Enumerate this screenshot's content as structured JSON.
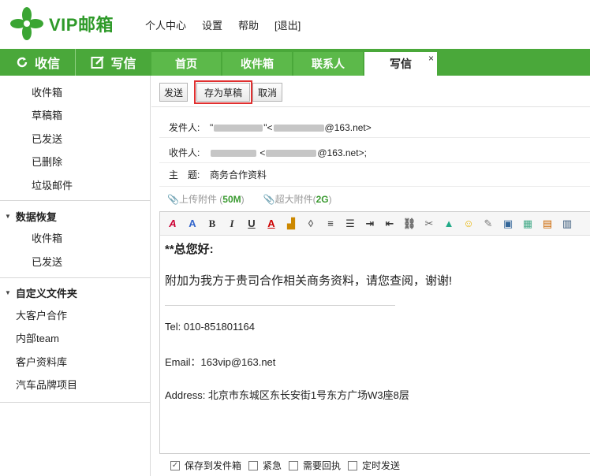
{
  "brand": {
    "name": "VIP邮箱",
    "logo_icon": "clover-logo-icon",
    "color": "#2f9a2a"
  },
  "topnav": [
    "个人中心",
    "设置",
    "帮助",
    "[退出]"
  ],
  "actions": {
    "receive": "收信",
    "compose": "写信",
    "receive_icon": "refresh-icon",
    "compose_icon": "compose-icon"
  },
  "tabs": [
    {
      "label": "首页"
    },
    {
      "label": "收件箱"
    },
    {
      "label": "联系人"
    },
    {
      "label": "写信",
      "active": true,
      "close": "×"
    }
  ],
  "sidebar": {
    "folders": [
      "收件箱",
      "草稿箱",
      "已发送",
      "已删除",
      "垃圾邮件"
    ],
    "recovery": {
      "title": "数据恢复",
      "items": [
        "收件箱",
        "已发送"
      ]
    },
    "custom": {
      "title": "自定义文件夹",
      "items": [
        "大客户合作",
        "内部team",
        "客户资料库",
        "汽车品牌项目"
      ]
    }
  },
  "compose": {
    "buttons": {
      "send": "发送",
      "draft": "存为草稿",
      "cancel": "取消"
    },
    "from_label": "发件人:",
    "from_visible": "@163.net>",
    "to_label": "收件人:",
    "to_visible": "@163.net>;",
    "subject_label": "主　题:",
    "subject": "商务合作资料",
    "attach_upload": "上传附件 (",
    "attach_upload_size": "50M",
    "attach_big": "超大附件(",
    "attach_big_size": "2G",
    "close_paren": ")"
  },
  "editor": {
    "greeting": "**总您好:",
    "body": "附加为我方于贵司合作相关商务资料，请您查阅，谢谢!",
    "tel": "Tel: 010-851801164",
    "email": "Email：163vip@163.net",
    "address": "Address: 北京市东城区东长安街1号东方广场W3座8层"
  },
  "options": [
    {
      "label": "保存到发件箱",
      "checked": true
    },
    {
      "label": "紧急",
      "checked": false
    },
    {
      "label": "需要回执",
      "checked": false
    },
    {
      "label": "定时发送",
      "checked": false
    }
  ],
  "colors": {
    "green_bar": "#4aa83a",
    "tab_green": "#5cb94a",
    "highlight": "#e03030"
  }
}
